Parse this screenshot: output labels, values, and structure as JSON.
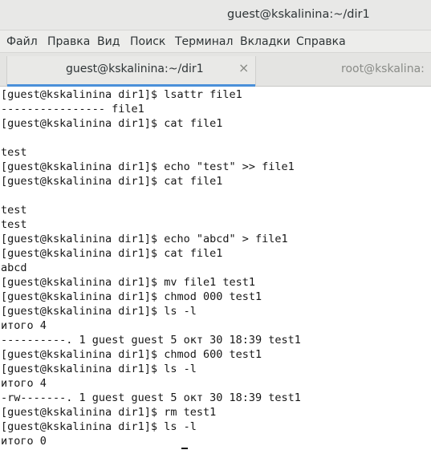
{
  "window": {
    "title": "guest@kskalinina:~/dir1"
  },
  "menu": {
    "items": [
      "Файл",
      "Правка",
      "Вид",
      "Поиск",
      "Терминал",
      "Вкладки",
      "Справка"
    ]
  },
  "tabs": [
    {
      "label": "guest@kskalinina:~/dir1",
      "active": true,
      "close_glyph": "×"
    },
    {
      "label": "root@kskalina:",
      "active": false
    }
  ],
  "terminal": {
    "lines": [
      "[guest@kskalinina dir1]$ lsattr file1",
      "---------------- file1",
      "[guest@kskalinina dir1]$ cat file1",
      "",
      "test",
      "[guest@kskalinina dir1]$ echo \"test\" >> file1",
      "[guest@kskalinina dir1]$ cat file1",
      "",
      "test",
      "test",
      "[guest@kskalinina dir1]$ echo \"abcd\" > file1",
      "[guest@kskalinina dir1]$ cat file1",
      "abcd",
      "[guest@kskalinina dir1]$ mv file1 test1",
      "[guest@kskalinina dir1]$ chmod 000 test1",
      "[guest@kskalinina dir1]$ ls -l",
      "итого 4",
      "----------. 1 guest guest 5 окт 30 18:39 test1",
      "[guest@kskalinina dir1]$ chmod 600 test1",
      "[guest@kskalinina dir1]$ ls -l",
      "итого 4",
      "-rw-------. 1 guest guest 5 окт 30 18:39 test1",
      "[guest@kskalinina dir1]$ rm test1",
      "[guest@kskalinina dir1]$ ls -l",
      "итого 0"
    ]
  }
}
